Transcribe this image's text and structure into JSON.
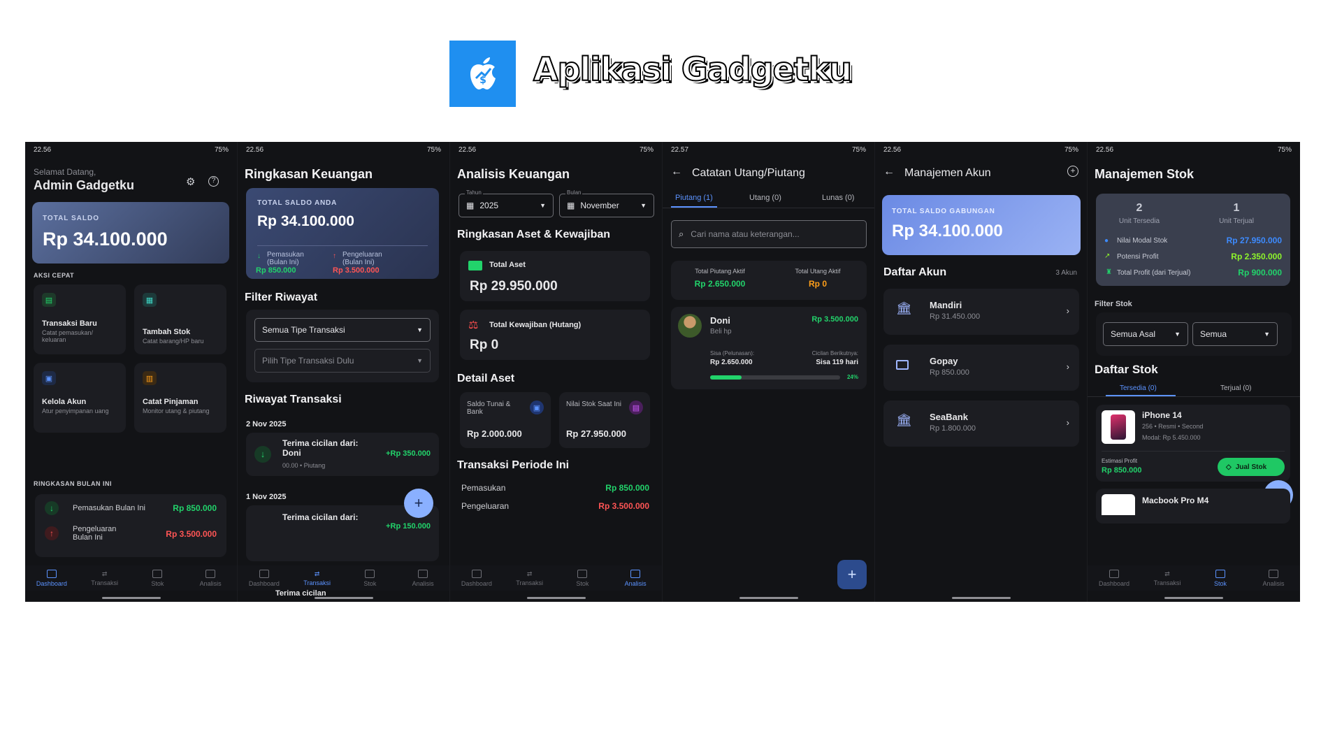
{
  "app_title": "Aplikasi Gadgetku",
  "screens": {
    "dashboard": {
      "status_time": "22.56",
      "status_right": "75%",
      "greeting": "Selamat Datang,",
      "user": "Admin Gadgetku",
      "saldo_label": "TOTAL SALDO",
      "saldo_value": "Rp 34.100.000",
      "quick_label": "AKSI CEPAT",
      "actions": [
        {
          "title": "Transaksi Baru",
          "sub": "Catat pemasukan/ keluaran"
        },
        {
          "title": "Tambah Stok",
          "sub": "Catat barang/HP baru"
        },
        {
          "title": "Kelola Akun",
          "sub": "Atur penyimpanan uang"
        },
        {
          "title": "Catat Pinjaman",
          "sub": "Monitor utang & piutang"
        }
      ],
      "summary_label": "RINGKASAN BULAN INI",
      "summary": [
        {
          "label": "Pemasukan Bulan Ini",
          "value": "Rp 850.000"
        },
        {
          "label": "Pengeluaran Bulan Ini",
          "value": "Rp 3.500.000"
        }
      ]
    },
    "transaksi": {
      "status_time": "22.56",
      "status_right": "75%",
      "title": "Ringkasan Keuangan",
      "saldo_label": "TOTAL SALDO ANDA",
      "saldo_value": "Rp 34.100.000",
      "in_label": "Pemasukan (Bulan Ini)",
      "in_value": "Rp 850.000",
      "out_label": "Pengeluaran (Bulan Ini)",
      "out_value": "Rp 3.500.000",
      "filter_title": "Filter Riwayat",
      "filter_type": "Semua Tipe Transaksi",
      "filter_sub_placeholder": "Pilih Tipe Transaksi Dulu",
      "history_title": "Riwayat Transaksi",
      "date1": "2 Nov 2025",
      "tx1_title": "Terima cicilan dari: Doni",
      "tx1_sub": "00.00 • Piutang",
      "tx1_value": "+Rp 350.000",
      "date2": "1 Nov 2025",
      "tx2_title": "Terima cicilan dari:",
      "tx2_value": "+Rp 150.000",
      "tx3_title": "Terima cicilan"
    },
    "analisis": {
      "status_time": "22.56",
      "status_right": "75%",
      "title": "Analisis Keuangan",
      "year_label": "Tahun",
      "year_value": "2025",
      "month_label": "Bulan",
      "month_value": "November",
      "section1": "Ringkasan Aset & Kewajiban",
      "asset_label": "Total Aset",
      "asset_value": "Rp 29.950.000",
      "liab_label": "Total Kewajiban (Hutang)",
      "liab_value": "Rp 0",
      "section2": "Detail Aset",
      "cash_label": "Saldo Tunai & Bank",
      "cash_value": "Rp 2.000.000",
      "stock_label": "Nilai Stok Saat Ini",
      "stock_value": "Rp 27.950.000",
      "section3": "Transaksi Periode Ini",
      "period_in_label": "Pemasukan",
      "period_in_value": "Rp 850.000",
      "period_out_label": "Pengeluaran",
      "period_out_value": "Rp 3.500.000"
    },
    "utang": {
      "status_time": "22.57",
      "status_right": "75%",
      "title": "Catatan Utang/Piutang",
      "tabs": [
        "Piutang (1)",
        "Utang (0)",
        "Lunas (0)"
      ],
      "search_placeholder": "Cari nama atau keterangan...",
      "piutang_label": "Total Piutang Aktif",
      "piutang_value": "Rp 2.650.000",
      "utang_label": "Total Utang Aktif",
      "utang_value": "Rp 0",
      "person_name": "Doni",
      "person_note": "Beli hp",
      "person_amount": "Rp 3.500.000",
      "sisa_label": "Sisa (Pelunasan):",
      "sisa_value": "Rp 2.650.000",
      "next_label": "Cicilan Berikutnya:",
      "next_value": "Sisa 119 hari",
      "progress_percent": 24,
      "progress_text": "24%"
    },
    "akun": {
      "status_time": "22.56",
      "status_right": "75%",
      "title": "Manajemen Akun",
      "saldo_label": "TOTAL SALDO GABUNGAN",
      "saldo_value": "Rp 34.100.000",
      "list_title": "Daftar Akun",
      "list_count": "3 Akun",
      "accounts": [
        {
          "name": "Mandiri",
          "value": "Rp 31.450.000"
        },
        {
          "name": "Gopay",
          "value": "Rp 850.000"
        },
        {
          "name": "SeaBank",
          "value": "Rp 1.800.000"
        }
      ]
    },
    "stok": {
      "status_time": "22.56",
      "status_right": "75%",
      "title": "Manajemen Stok",
      "unit_available": "2",
      "unit_available_label": "Unit Tersedia",
      "unit_sold": "1",
      "unit_sold_label": "Unit Terjual",
      "modal_label": "Nilai Modal Stok",
      "modal_value": "Rp 27.950.000",
      "potensi_label": "Potensi Profit",
      "potensi_value": "Rp 2.350.000",
      "profit_label": "Total Profit (dari Terjual)",
      "profit_value": "Rp 900.000",
      "filter_title": "Filter Stok",
      "filter_origin": "Semua Asal",
      "filter_all": "Semua",
      "list_title": "Daftar Stok",
      "tabs": [
        "Tersedia (0)",
        "Terjual (0)"
      ],
      "item_name": "iPhone 14",
      "item_sub": "256 • Resmi • Second",
      "item_modal": "Modal: Rp 5.450.000",
      "est_label": "Estimasi Profit",
      "est_value": "Rp 850.000",
      "sell_button": "Jual Stok",
      "item2_name": "Macbook Pro M4"
    }
  },
  "nav": [
    "Dashboard",
    "Transaksi",
    "Stok",
    "Analisis"
  ],
  "colors": {
    "background": "#121316",
    "card": "#1c1d22",
    "green": "#22d36b",
    "red": "#ff5555",
    "accent": "#5c93ff"
  }
}
